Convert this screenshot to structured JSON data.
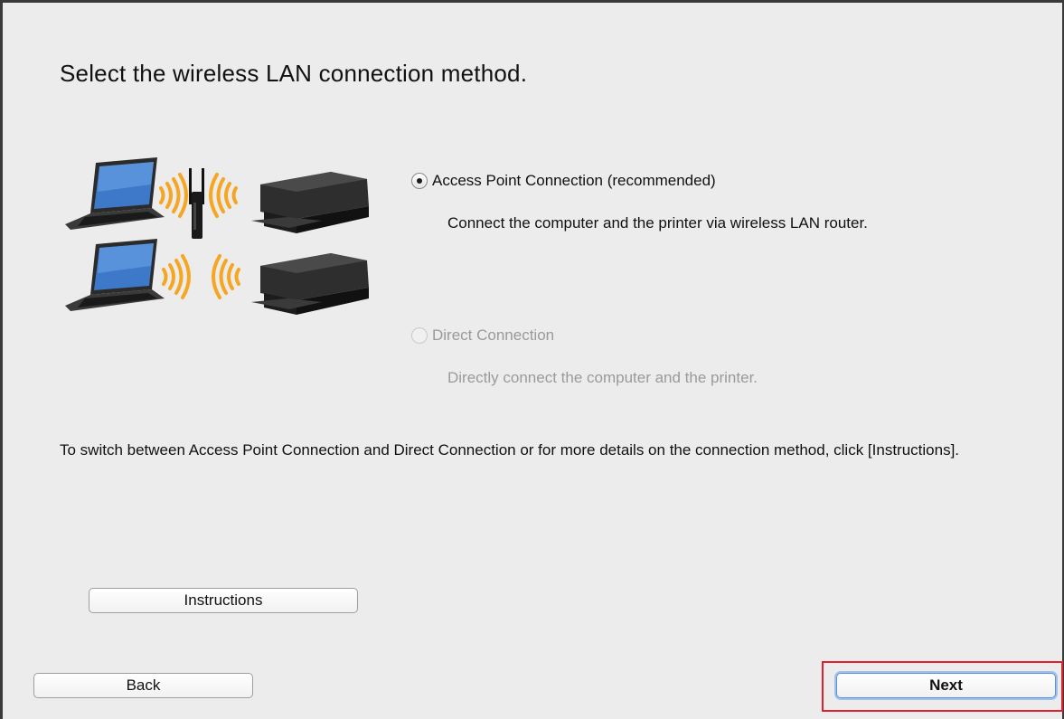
{
  "dialog": {
    "heading": "Select the wireless LAN connection method."
  },
  "options": [
    {
      "label": "Access Point Connection (recommended)",
      "description": "Connect the computer and the printer via wireless LAN router.",
      "selected": true,
      "enabled": true
    },
    {
      "label": "Direct Connection",
      "description": "Directly connect the computer and the printer.",
      "selected": false,
      "enabled": false
    }
  ],
  "info_text": "To switch between Access Point Connection and Direct Connection or for more details on the connection method, click [Instructions].",
  "buttons": {
    "instructions": "Instructions",
    "back": "Back",
    "next": "Next"
  },
  "icons": {
    "illustration_access_point": [
      "laptop-icon",
      "wifi-waves-icon",
      "wireless-router-icon",
      "printer-icon"
    ],
    "illustration_direct": [
      "laptop-icon",
      "wifi-waves-icon",
      "printer-icon"
    ]
  },
  "colors": {
    "background": "#ececec",
    "highlight": "#e0202a",
    "wifi": "#f5a623",
    "default_button_ring": "#5b8fd6",
    "disabled_text": "#9a9a9a"
  }
}
